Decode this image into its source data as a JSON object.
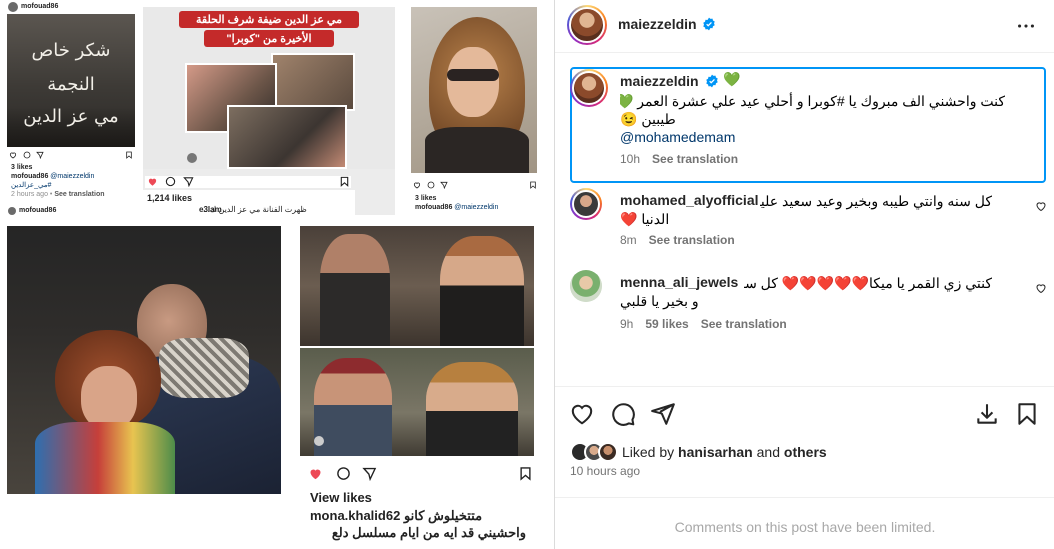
{
  "collage": {
    "tile1": {
      "overlay_lines": [
        "شكر خاص",
        "النجمة",
        "مي عز الدين"
      ],
      "header_user": "mofouad86",
      "likes": "3 likes",
      "caption_user": "mofouad86",
      "caption_mention": "@maiezzeldin",
      "caption_tag": "#مي_عزالدين",
      "time": "2 hours ago",
      "see_translation": "See translation",
      "next_user": "mofouad86"
    },
    "tile2": {
      "headline_line1": "مي عز الدين ضيفة شرف الحلقة",
      "headline_line2": "الأخيرة من \"كوبرا\"",
      "likes": "1,214 likes",
      "caption": "ظهرت الفنانة مي عز الدين ك...",
      "user": "e3lam"
    },
    "tile3": {
      "likes": "3 likes",
      "caption_user": "mofouad86",
      "caption_mention": "@maiezzeldin"
    },
    "tile5": {
      "view_likes": "View likes",
      "caption_user": "mona.khalid62",
      "caption_text": "متتخيلوش كانو",
      "caption_line2": "واحشيني قد ايه من ايام مسلسل دلع"
    }
  },
  "header": {
    "username": "maiezzeldin",
    "more_icon": "more-horizontal-icon"
  },
  "post_caption": {
    "username": "maiezzeldin",
    "emoji": "💚",
    "text_line1": "كنت واحشني الف مبروك يا #كوبرا و أحلي عيد علي عشرة العمر 💚 كل سنة و إنتم",
    "text_line2": "طيبين 😉",
    "mention": "@mohamedemam",
    "time": "10h",
    "see_translation": "See translation"
  },
  "comments": [
    {
      "username": "mohamed_alyofficial",
      "text_line1": "كل سنه وانتي طيبه وبخير وعيد سعيد عليكي ومنوره",
      "text_line2": "الدنيا ❤️",
      "time": "8m",
      "likes": "",
      "see_translation": "See translation"
    },
    {
      "username": "menna_ali_jewels",
      "text_line1": "كنتي زي القمر يا ميكا❤️❤️❤️❤️❤️ كل سنه وانتي طيبه",
      "text_line2": "و بخير يا قلبي",
      "time": "9h",
      "likes": "59 likes",
      "see_translation": "See translation"
    }
  ],
  "actions": {
    "like_icon": "heart-icon",
    "comment_icon": "comment-icon",
    "share_icon": "send-icon",
    "download_icon": "download-icon",
    "save_icon": "bookmark-icon"
  },
  "liked_by": {
    "prefix": "Liked by",
    "user": "hanisarhan",
    "and": "and",
    "others": "others"
  },
  "post_time": "10 hours ago",
  "comments_limited": "Comments on this post have been limited.",
  "colors": {
    "brand_blue": "#0095f6",
    "highlight_border": "#0095f6",
    "link_blue": "#00376b",
    "like_red": "#ed4956",
    "muted": "#737373",
    "verified_blue": "#0095f6"
  }
}
